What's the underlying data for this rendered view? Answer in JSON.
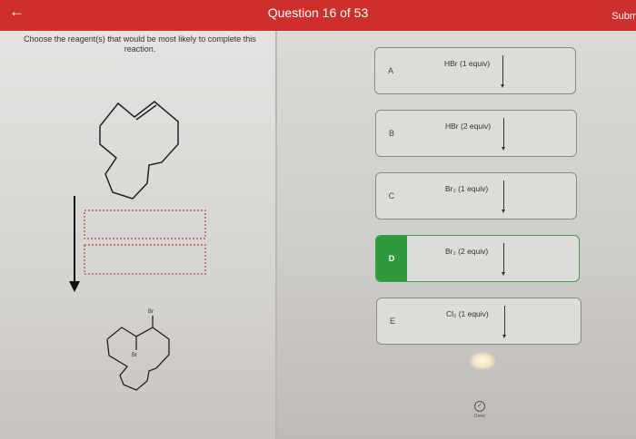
{
  "header": {
    "back_icon": "left-arrow-icon",
    "title": "Question 16 of 53",
    "submit_label": "Subm"
  },
  "question": {
    "prompt": "Choose the reagent(s) that would be most likely to complete this reaction."
  },
  "reaction": {
    "reactant_ring": "cycloalkene",
    "product_labels": [
      "Br",
      "Br"
    ]
  },
  "choices": [
    {
      "letter": "A",
      "reagent": "HBr (1 equiv)",
      "selected": false
    },
    {
      "letter": "B",
      "reagent": "HBr (2 equiv)",
      "selected": false
    },
    {
      "letter": "C",
      "reagent": "Br₂ (1 equiv)",
      "selected": false
    },
    {
      "letter": "D",
      "reagent": "Br₂ (2 equiv)",
      "selected": true
    },
    {
      "letter": "E",
      "reagent": "Cl₂ (1 equiv)",
      "selected": false
    }
  ],
  "done": {
    "label": "Done",
    "icon": "check-circle-icon"
  },
  "colors": {
    "header": "#cf2f2c",
    "selected": "#2e9a3d"
  }
}
